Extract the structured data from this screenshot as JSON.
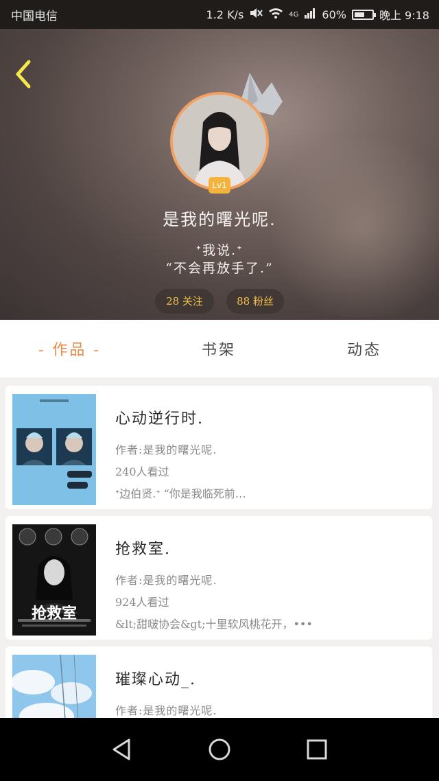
{
  "status_bar": {
    "carrier": "中国电信",
    "speed": "1.2 K/s",
    "signal": "4G",
    "battery_percent": "60%",
    "time": "晚上 9:18",
    "battery_level": 0.6
  },
  "profile": {
    "level_badge": "Lv1",
    "username": "是我的曙光呢.",
    "bio_line1": "ᕀ我说.ᕀ",
    "bio_line2": "“不会再放手了.”",
    "following_label": "28 关注",
    "fans_label": "88 粉丝"
  },
  "tabs": [
    {
      "label": "- 作品 -",
      "active": true
    },
    {
      "label": "书架",
      "active": false
    },
    {
      "label": "动态",
      "active": false
    }
  ],
  "works": [
    {
      "title": "心动逆行时.",
      "author": "作者:是我的曙光呢.",
      "views": "240人看过",
      "desc": "ᕀ边伯贤.ᕀ “你是我临死前…"
    },
    {
      "title": "抢救室.",
      "author": "作者:是我的曙光呢.",
      "views": "924人看过",
      "desc": "&lt;甜啵协会&gt;十里软风桃花开，•••",
      "cover_text": "抢救室"
    },
    {
      "title": "璀璨心动_.",
      "author": "作者:是我的曙光呢.",
      "views": "",
      "desc": ""
    }
  ],
  "colors": {
    "accent": "#ee8a4a",
    "level_badge": "#f3b33d",
    "pill_text": "#f2c14a",
    "back_arrow": "#f4e84a"
  }
}
